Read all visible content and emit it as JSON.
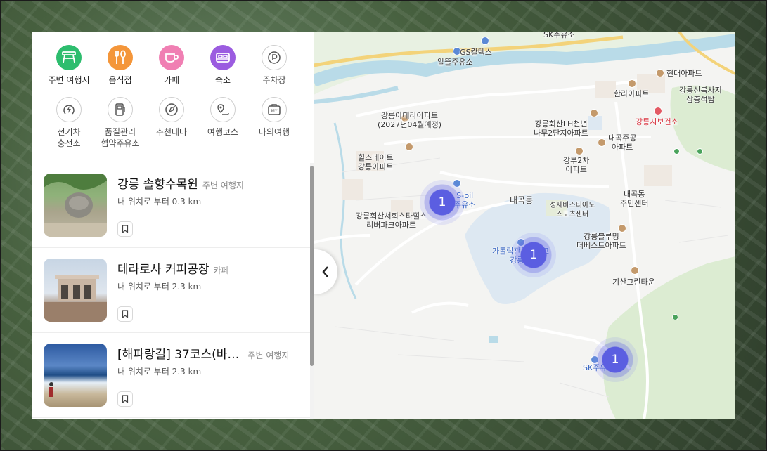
{
  "categories": [
    {
      "label": "주변 여행지",
      "icon": "table-icon",
      "color": "#2dbd6e",
      "filled": true
    },
    {
      "label": "음식점",
      "icon": "utensils-icon",
      "color": "#f4963a",
      "filled": true
    },
    {
      "label": "카페",
      "icon": "coffee-cup-icon",
      "color": "#f07fb3",
      "filled": true
    },
    {
      "label": "숙소",
      "icon": "bed-icon",
      "color": "#9b5ce0",
      "filled": true
    },
    {
      "label": "주차장",
      "icon": "parking-icon",
      "color": "#555555",
      "filled": false
    },
    {
      "label": "전기차\n충전소",
      "icon": "ev-charger-icon",
      "color": "#555555",
      "filled": false
    },
    {
      "label": "품질관리\n협약주유소",
      "icon": "gas-pump-icon",
      "color": "#555555",
      "filled": false
    },
    {
      "label": "추천테마",
      "icon": "theme-compass-icon",
      "color": "#555555",
      "filled": false
    },
    {
      "label": "여행코스",
      "icon": "route-icon",
      "color": "#555555",
      "filled": false
    },
    {
      "label": "나의여행",
      "icon": "my-bag-icon",
      "color": "#555555",
      "filled": false
    }
  ],
  "places": [
    {
      "title": "강릉 솔향수목원",
      "category": "주변 여행지",
      "distance": "내 위치로 부터 0.3 km"
    },
    {
      "title": "테라로사 커피공장",
      "category": "카페",
      "distance": "내 위치로 부터 2.3 km"
    },
    {
      "title": "[해파랑길] 37코스(바…",
      "category": "주변 여행지",
      "distance": "내 위치로 부터 2.3 km"
    }
  ],
  "map": {
    "labels": {
      "sk_top": "SK주유소",
      "gs": "GS칼텍스",
      "altteul": "알뜰주유소",
      "hyundai": "현대아파트",
      "hanra": "한라아파트",
      "sinboksa": "강릉신복사지\n삼층석탑",
      "health": "강릉시보건소",
      "terra_apt": "강릉아테라아파트\n(2027년04월예정)",
      "lh": "강릉회산LH천년\n나무2단지아파트",
      "naegok_jugong": "내곡주공\n아파트",
      "hillstate": "힐스테이트\n강릉아파트",
      "gangbu": "강부2차\n아파트",
      "s_oil": "S-oil\n주유소",
      "naegok_dong": "내곡동",
      "naegok_center": "내곡동\n주민센터",
      "sports": "성세바스티아노\n스포츠센터",
      "riverpark": "강릉회산서희스타힐스\n리버파크아파트",
      "catholic": "가톨릭관동대학교\n강릉캠",
      "bluming": "강릉블루밍\n더베스트아파트",
      "gisan": "기산그린타운",
      "sk_bottom": "SK주유소"
    },
    "clusters": [
      "1",
      "1",
      "1"
    ]
  },
  "colors": {
    "cluster": "#5b5ee1",
    "river": "#b9dbe8",
    "park": "#dcecd2",
    "road_major": "#f6d77a"
  }
}
